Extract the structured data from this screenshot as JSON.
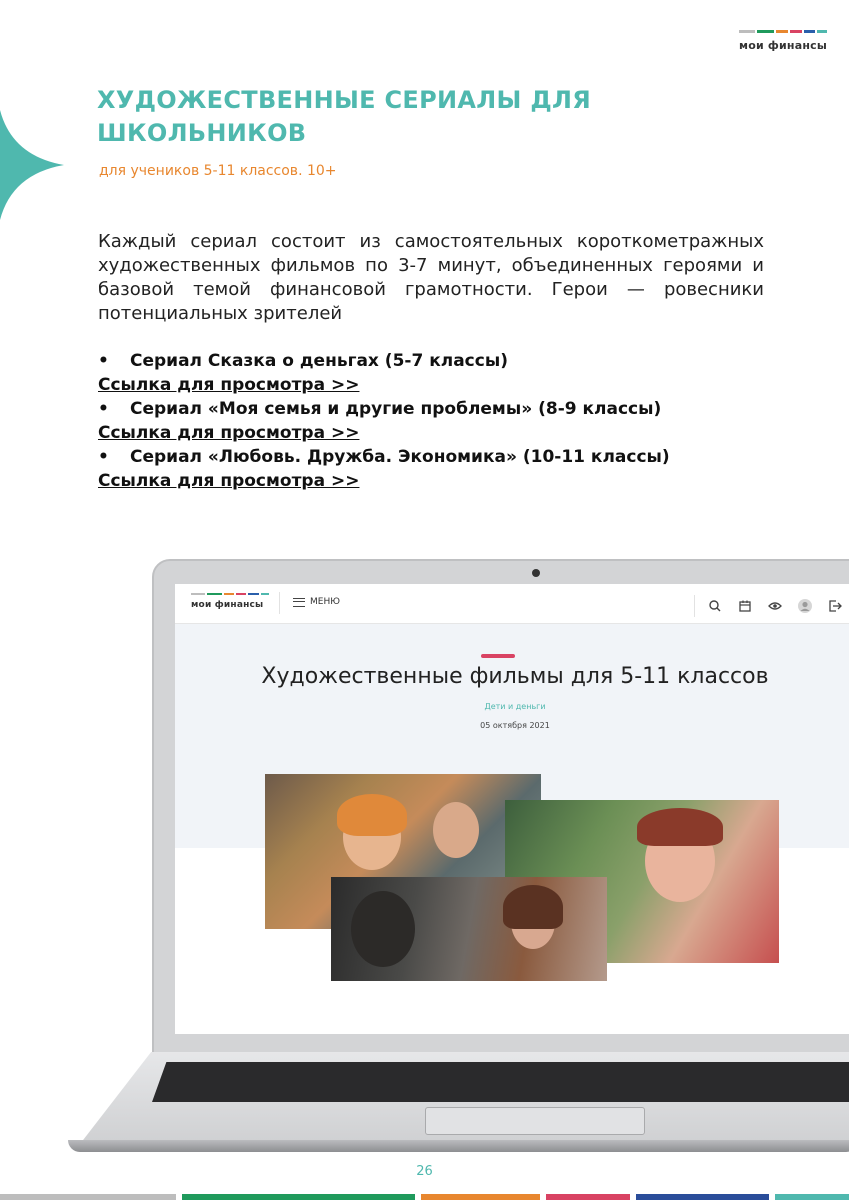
{
  "colors": {
    "teal": "#4fb8ae",
    "orange": "#e8872f",
    "pink": "#d94363",
    "logo_bars": [
      "#bdbdbd",
      "#1f9a5c",
      "#e8872f",
      "#d94363",
      "#2a5fab",
      "#4fb8ae"
    ],
    "footer_bars": [
      "#bdbdbd",
      "#1f9a5c",
      "#e8872f",
      "#d94363",
      "#2a4d9a",
      "#4fb8ae"
    ]
  },
  "header": {
    "logo_text": "мои финансы"
  },
  "title": "ХУДОЖЕСТВЕННЫЕ СЕРИАЛЫ ДЛЯ ШКОЛЬНИКОВ",
  "subtitle": "для учеников 5-11 классов. 10+",
  "intro": "Каждый сериал состоит из самостоятельных короткометражных художественных фильмов по 3-7 минут, объединенных героями и базовой темой финансовой грамотности. Герои — ровесники потенциальных зрителей",
  "series": [
    {
      "bullet": "•",
      "title": "Сериал Сказка о деньгах (5-7 классы)",
      "link": "Ссылка для просмотра >>"
    },
    {
      "bullet": "•",
      "title": "Сериал «Моя семья и другие проблемы» (8-9 классы)",
      "link": "Ссылка для просмотра >>"
    },
    {
      "bullet": "•",
      "title": "Сериал «Любовь. Дружба. Экономика» (10-11 классы)",
      "link": "Ссылка для просмотра >>"
    }
  ],
  "screen": {
    "logo_text": "мои финансы",
    "menu_label": "МЕНЮ",
    "icons": [
      "search-icon",
      "calendar-icon",
      "eye-icon",
      "user-avatar-icon",
      "logout-icon"
    ],
    "article_title": "Художественные фильмы для 5-11 классов",
    "category": "Дети и деньги",
    "date": "05 октября 2021"
  },
  "page_number": "26"
}
